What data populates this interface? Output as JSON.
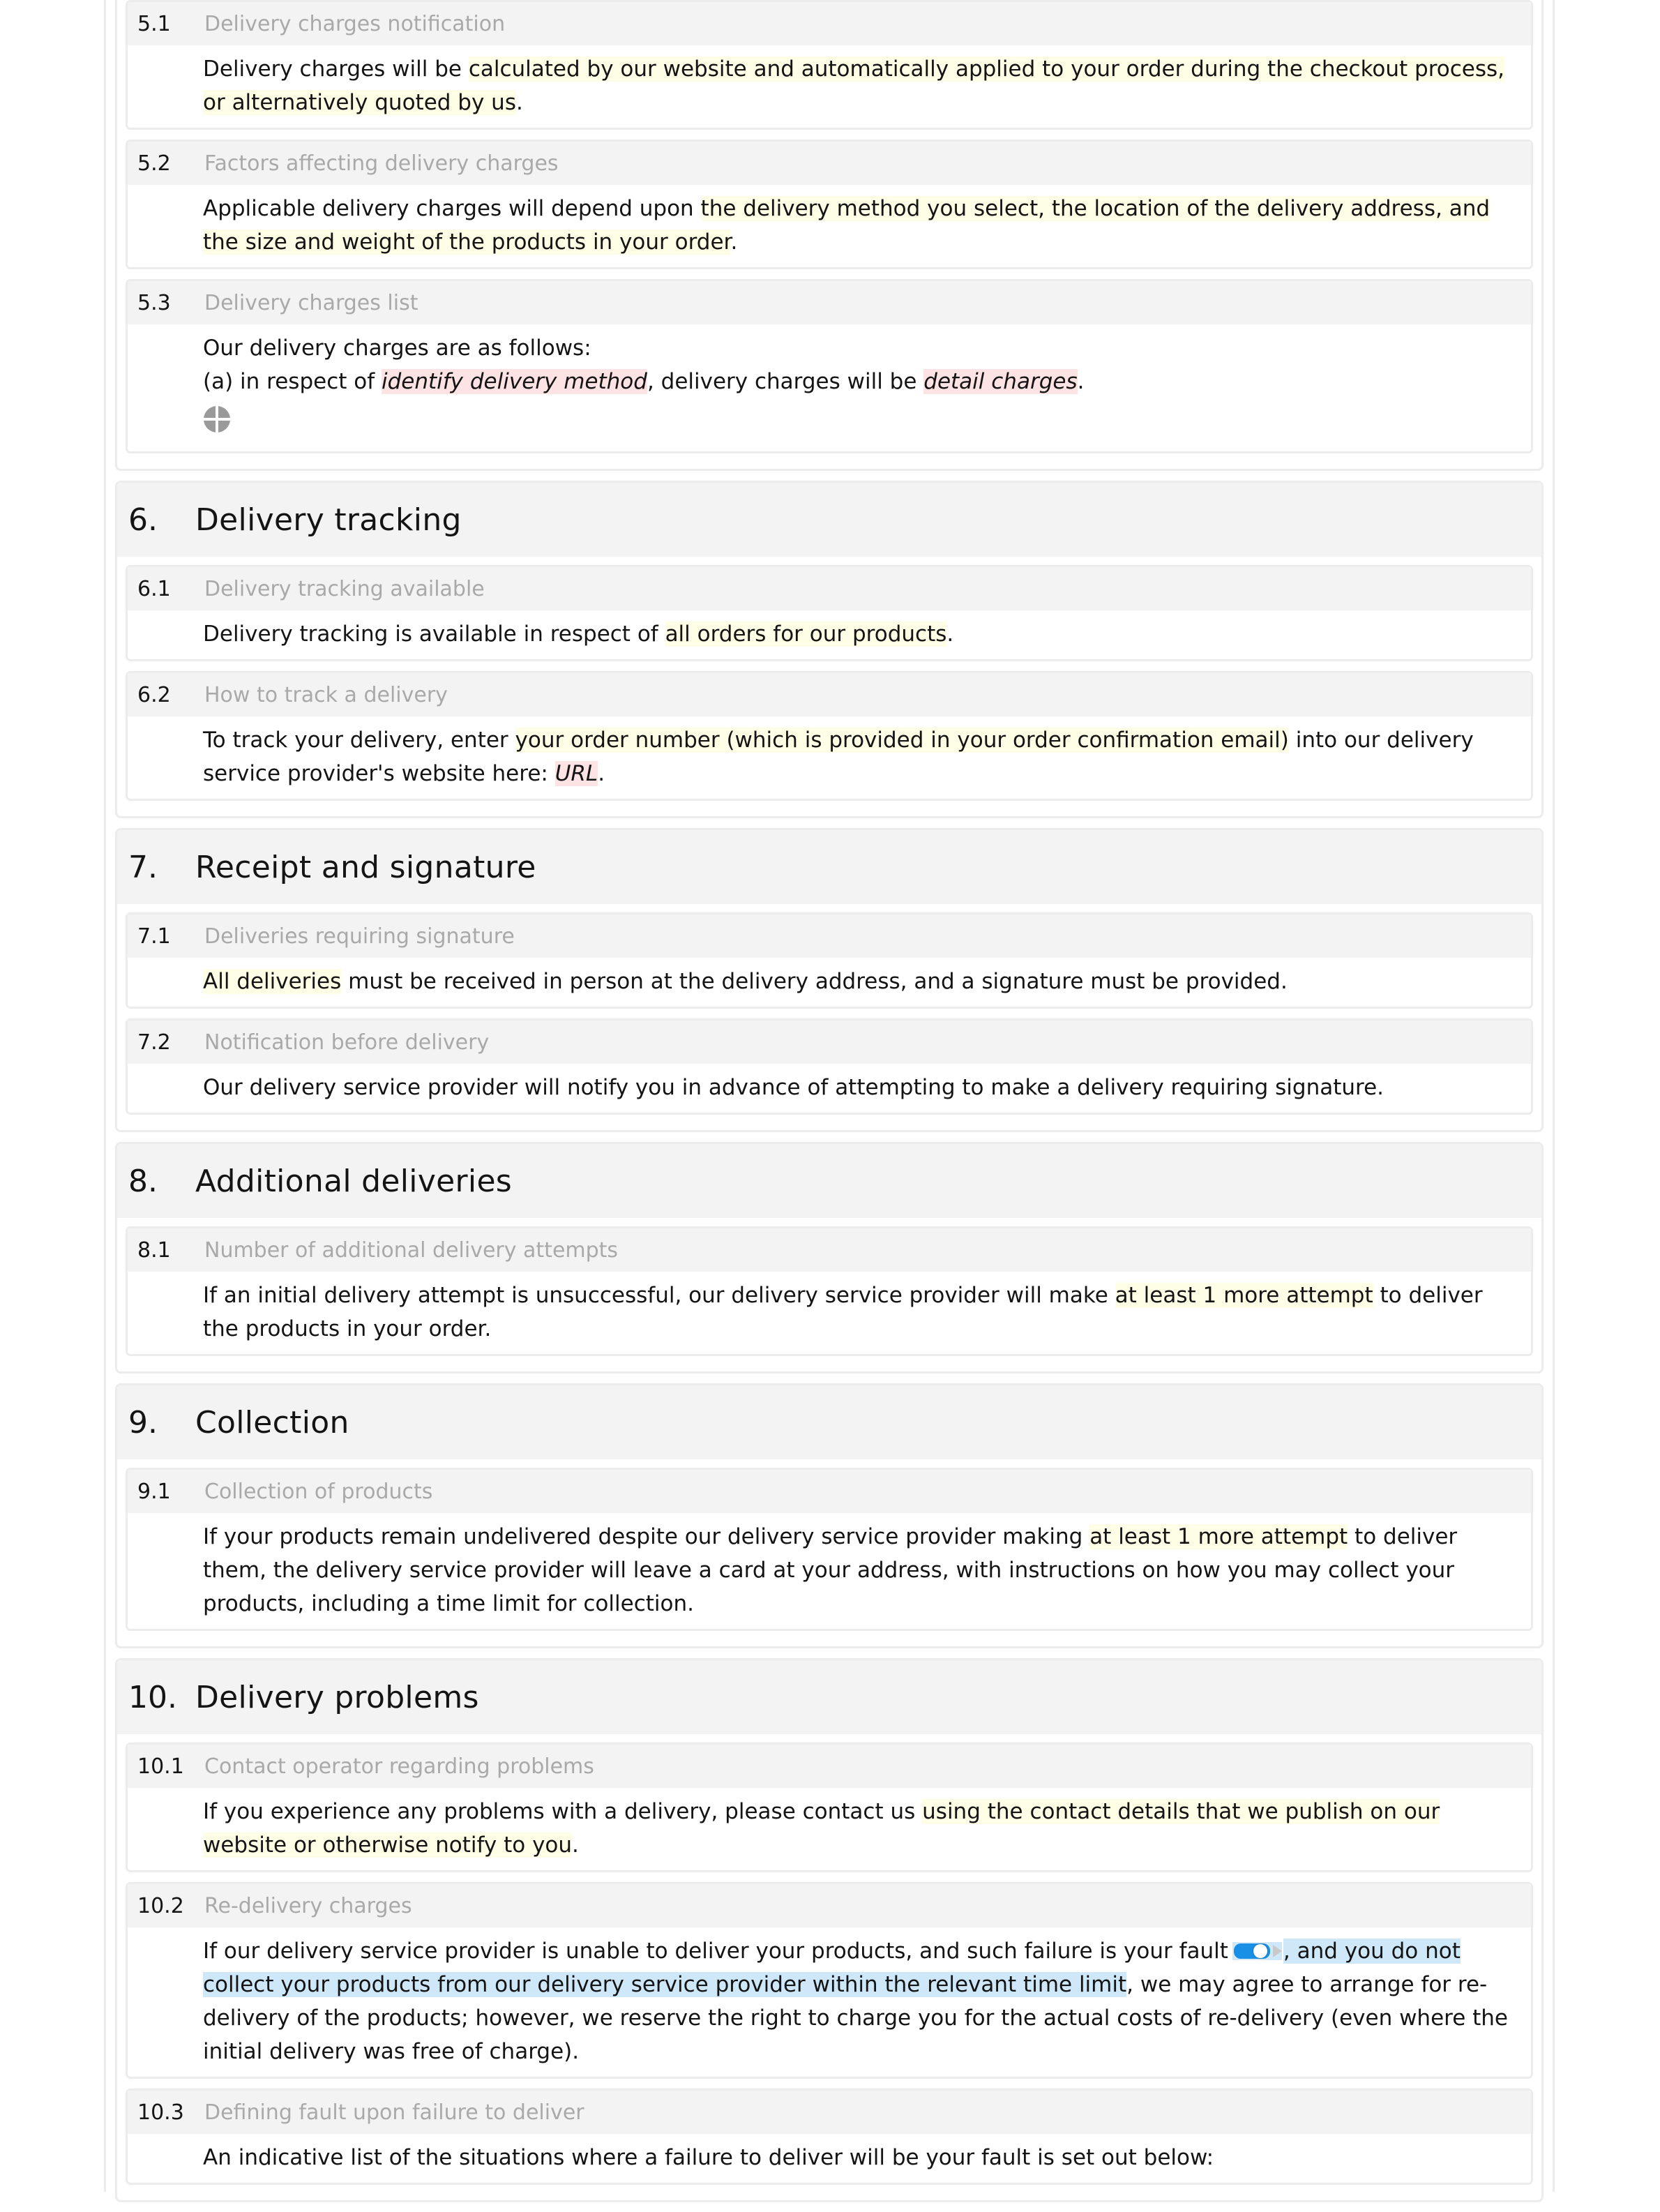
{
  "document": {
    "sections": [
      {
        "number": "5.",
        "title": "",
        "continued": true,
        "clauses": [
          {
            "number": "5.1",
            "title": "Delivery charges notification",
            "paragraphs": [
              [
                {
                  "text": "Delivery charges will be ",
                  "style": "plain"
                },
                {
                  "text": "calculated by our website and automatically applied to your order during the checkout process, or alternatively quoted by us",
                  "style": "yellow"
                },
                {
                  "text": ".",
                  "style": "plain"
                }
              ]
            ]
          },
          {
            "number": "5.2",
            "title": "Factors affecting delivery charges",
            "paragraphs": [
              [
                {
                  "text": "Applicable delivery charges will depend upon ",
                  "style": "plain"
                },
                {
                  "text": "the delivery method you select, the location of the delivery address, and the size and weight of the products in your order",
                  "style": "yellow"
                },
                {
                  "text": ".",
                  "style": "plain"
                }
              ]
            ]
          },
          {
            "number": "5.3",
            "title": "Delivery charges list",
            "paragraphs": [
              [
                {
                  "text": "Our delivery charges are as follows:",
                  "style": "plain"
                }
              ],
              [
                {
                  "text": "(a)  in respect of ",
                  "style": "plain"
                },
                {
                  "text": "identify delivery method",
                  "style": "red"
                },
                {
                  "text": ", delivery charges will be ",
                  "style": "plain"
                },
                {
                  "text": "detail charges",
                  "style": "red"
                },
                {
                  "text": ".",
                  "style": "plain"
                }
              ]
            ],
            "add_item_icon": "add-circle-icon"
          }
        ]
      },
      {
        "number": "6.",
        "title": "Delivery tracking",
        "clauses": [
          {
            "number": "6.1",
            "title": "Delivery tracking available",
            "paragraphs": [
              [
                {
                  "text": "Delivery tracking is available in respect of ",
                  "style": "plain"
                },
                {
                  "text": "all orders for our products",
                  "style": "yellow"
                },
                {
                  "text": ".",
                  "style": "plain"
                }
              ]
            ]
          },
          {
            "number": "6.2",
            "title": "How to track a delivery",
            "paragraphs": [
              [
                {
                  "text": "To track your delivery, enter ",
                  "style": "plain"
                },
                {
                  "text": "your order number (which is provided in your order confirmation email)",
                  "style": "yellow"
                },
                {
                  "text": " into our delivery service provider's website here: ",
                  "style": "plain"
                },
                {
                  "text": "URL",
                  "style": "red"
                },
                {
                  "text": ".",
                  "style": "plain"
                }
              ]
            ]
          }
        ]
      },
      {
        "number": "7.",
        "title": "Receipt and signature",
        "clauses": [
          {
            "number": "7.1",
            "title": "Deliveries requiring signature",
            "paragraphs": [
              [
                {
                  "text": "All deliveries",
                  "style": "yellow"
                },
                {
                  "text": " must be received in person at the delivery address, and a signature must be provided.",
                  "style": "plain"
                }
              ]
            ]
          },
          {
            "number": "7.2",
            "title": "Notification before delivery",
            "paragraphs": [
              [
                {
                  "text": "Our delivery service provider will notify you in advance of attempting to make a delivery requiring signature.",
                  "style": "plain"
                }
              ]
            ]
          }
        ]
      },
      {
        "number": "8.",
        "title": "Additional deliveries",
        "clauses": [
          {
            "number": "8.1",
            "title": "Number of additional delivery attempts",
            "paragraphs": [
              [
                {
                  "text": "If an initial delivery attempt is unsuccessful, our delivery service provider will make ",
                  "style": "plain"
                },
                {
                  "text": "at least 1 more attempt",
                  "style": "yellow"
                },
                {
                  "text": " to deliver the products in your order.",
                  "style": "plain"
                }
              ]
            ]
          }
        ]
      },
      {
        "number": "9.",
        "title": "Collection",
        "clauses": [
          {
            "number": "9.1",
            "title": "Collection of products",
            "paragraphs": [
              [
                {
                  "text": "If your products remain undelivered despite our delivery service provider making ",
                  "style": "plain"
                },
                {
                  "text": "at least 1 more attempt",
                  "style": "yellow"
                },
                {
                  "text": " to deliver them, the delivery service provider will leave a card at your address, with instructions on how you may collect your products, including a time limit for collection.",
                  "style": "plain"
                }
              ]
            ]
          }
        ]
      },
      {
        "number": "10.",
        "title": "Delivery problems",
        "clauses": [
          {
            "number": "10.1",
            "title": "Contact operator regarding problems",
            "paragraphs": [
              [
                {
                  "text": "If you experience any problems with a delivery, please contact us ",
                  "style": "plain"
                },
                {
                  "text": "using the contact details that we publish on our website or otherwise notify to you",
                  "style": "yellow"
                },
                {
                  "text": ".",
                  "style": "plain"
                }
              ]
            ]
          },
          {
            "number": "10.2",
            "title": "Re-delivery charges",
            "paragraphs": [
              [
                {
                  "text": "If our delivery service provider is unable to deliver your products, and such failure is your fault",
                  "style": "plain"
                },
                {
                  "text": "",
                  "style": "toggle",
                  "toggle_on": true,
                  "icon": "toggle-switch-icon",
                  "arrow_icon": "expand-arrow-icon"
                },
                {
                  "text": ", and you do not collect your products from our delivery service provider within the relevant time limit",
                  "style": "blue"
                },
                {
                  "text": ", we may agree to arrange for re-delivery of the products; however, we reserve the right to charge you for the actual costs of re-delivery (even where the initial delivery was free of charge).",
                  "style": "plain"
                }
              ]
            ]
          },
          {
            "number": "10.3",
            "title": "Defining fault upon failure to deliver",
            "paragraphs": [
              [
                {
                  "text": "An indicative list of the situations where a failure to deliver will be your fault is set out below:",
                  "style": "plain"
                }
              ]
            ]
          }
        ]
      }
    ]
  },
  "colors": {
    "highlight_yellow": "#fefde5",
    "highlight_red": "#fde3e3",
    "highlight_blue": "#cfe8f9",
    "toggle_on": "#1a8fe6",
    "band_gray": "#f3f3f3",
    "title_gray": "#a9a9a9"
  }
}
